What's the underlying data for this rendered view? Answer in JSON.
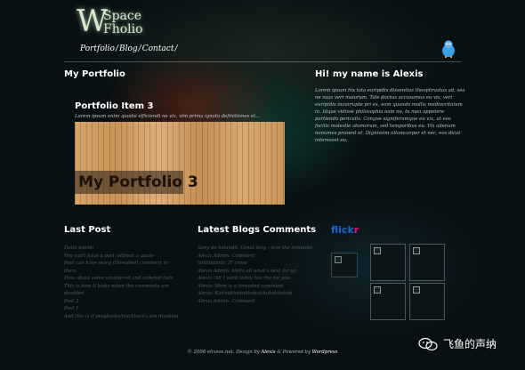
{
  "logo": {
    "letter": "W",
    "line1": "Space",
    "line2": "Fholio"
  },
  "nav": {
    "items": [
      "Portfolio",
      "Blog",
      "Contact"
    ],
    "separator": "/"
  },
  "portfolio": {
    "heading": "My Portfolio",
    "item_title": "Portfolio Item 3",
    "item_desc": "Lorem ipsum enim quodsi efficiendi ne vix, vim prima ignota definitiones et...",
    "image_caption": "My Portfolio 3"
  },
  "about": {
    "heading": "Hi! my name is Alexis",
    "text": "Lorem ipsum his tota euripidis dissentias theophrastus ad, sea ne suas veri maiorum. Tale doctus accusamus eu vis, veri euripidis incorrupte pri ex, eam quando mollis mediocritatem in. Idque vidisse philosophia eam no, te mea appetere partiendo periculis. Congue signiferumque eu vix, ut eos facilis molestie atomorum, sed temporibus eu. Vix alienum nonumes prasent et. Dignissim ullamcorper et nec, eos dicat interesset eu."
  },
  "last_post": {
    "heading": "Last Post",
    "items": [
      "Hello world!",
      "You can't have a post without a quote",
      "Post can have many (threaded) comment in them",
      "How about some unordered and ordered lists",
      "This is how it looks when the comments are disabled",
      "Post 2",
      "Post 1",
      "And this is if pingbacks/trackbacks are disabled"
    ]
  },
  "latest_comments": {
    "heading": "Latest Blogs Comments",
    "items": [
      "Sany de holandit: Great blog - love the template",
      "Alexis Admin: Comment",
      "tttttttttttrtr: IT cross",
      "Alexis Admin: Hello all what's next for ya",
      "Alexis: All I want today has the for you",
      "Alexis: Here is a threaded comment",
      "Alexis: Kukhukhukukhukukhukukhukuk",
      "Alexis Admin: Comment"
    ]
  },
  "flickr": {
    "part1": "flick",
    "part2": "r"
  },
  "footer": {
    "prefix": "© 2008 elixeos.net. Design by",
    "author": "Alexis",
    "middle": "& Powered by",
    "engine": "Wordpress"
  },
  "watermark": "飞鱼的声纳",
  "colors": {
    "flickr_blue": "#1e66c8",
    "flickr_pink": "#ff0084",
    "bird": "#3aa0e8"
  }
}
